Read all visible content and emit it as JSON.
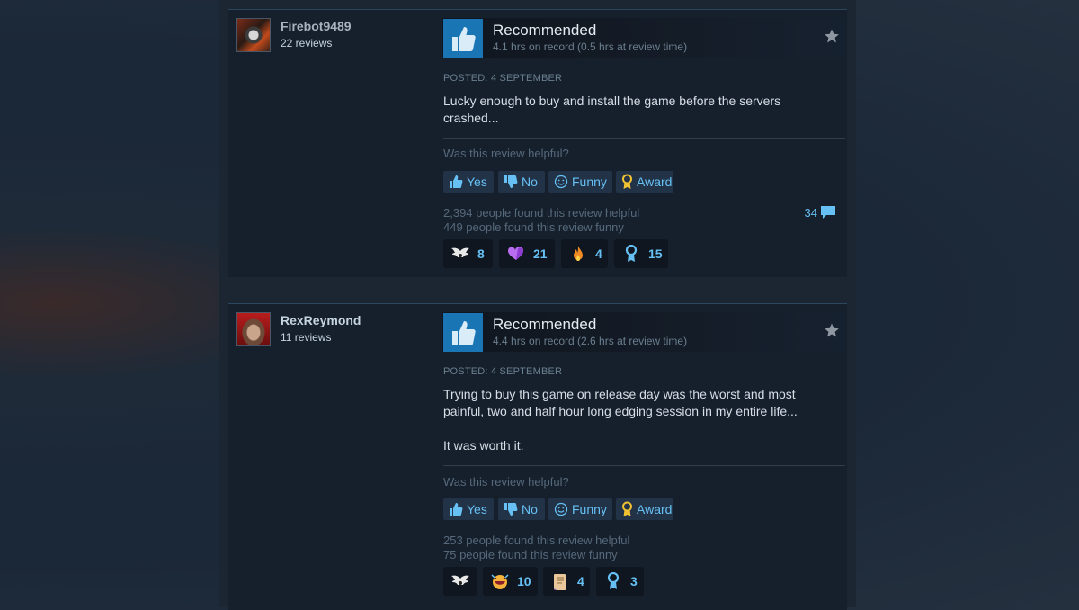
{
  "reviews": [
    {
      "author": "Firebot9489",
      "review_count": "22 reviews",
      "verdict": "Recommended",
      "hours": "4.1 hrs on record (0.5 hrs at review time)",
      "posted": "POSTED: 4 SEPTEMBER",
      "body": [
        "Lucky enough to buy and install the game before the servers crashed..."
      ],
      "helpful_question": "Was this review helpful?",
      "buttons": {
        "yes": "Yes",
        "no": "No",
        "funny": "Funny",
        "award": "Award"
      },
      "helpful_stat": "2,394 people found this review helpful",
      "funny_stat": "449 people found this review funny",
      "comments": "34",
      "awards": [
        {
          "icon": "winged-award-icon",
          "count": "8"
        },
        {
          "icon": "heart-award-icon",
          "count": "21"
        },
        {
          "icon": "flame-award-icon",
          "count": "4"
        },
        {
          "icon": "ribbon-award-icon",
          "count": "15"
        }
      ]
    },
    {
      "author": "RexReymond",
      "review_count": "11 reviews",
      "verdict": "Recommended",
      "hours": "4.4 hrs on record (2.6 hrs at review time)",
      "posted": "POSTED: 4 SEPTEMBER",
      "body": [
        "Trying to buy this game on release day was the worst and most painful, two and half hour long edging session in my entire life...",
        "It was worth it."
      ],
      "helpful_question": "Was this review helpful?",
      "buttons": {
        "yes": "Yes",
        "no": "No",
        "funny": "Funny",
        "award": "Award"
      },
      "helpful_stat": "253 people found this review helpful",
      "funny_stat": "75 people found this review funny",
      "awards": [
        {
          "icon": "winged-award-icon",
          "count": ""
        },
        {
          "icon": "laughing-face-award-icon",
          "count": "10"
        },
        {
          "icon": "scroll-award-icon",
          "count": "4"
        },
        {
          "icon": "ribbon-award-icon",
          "count": "3"
        }
      ]
    }
  ],
  "colors": {
    "accent": "#66c0f4",
    "thumb_bg": "#1a75b5",
    "panel": "#16202d"
  }
}
